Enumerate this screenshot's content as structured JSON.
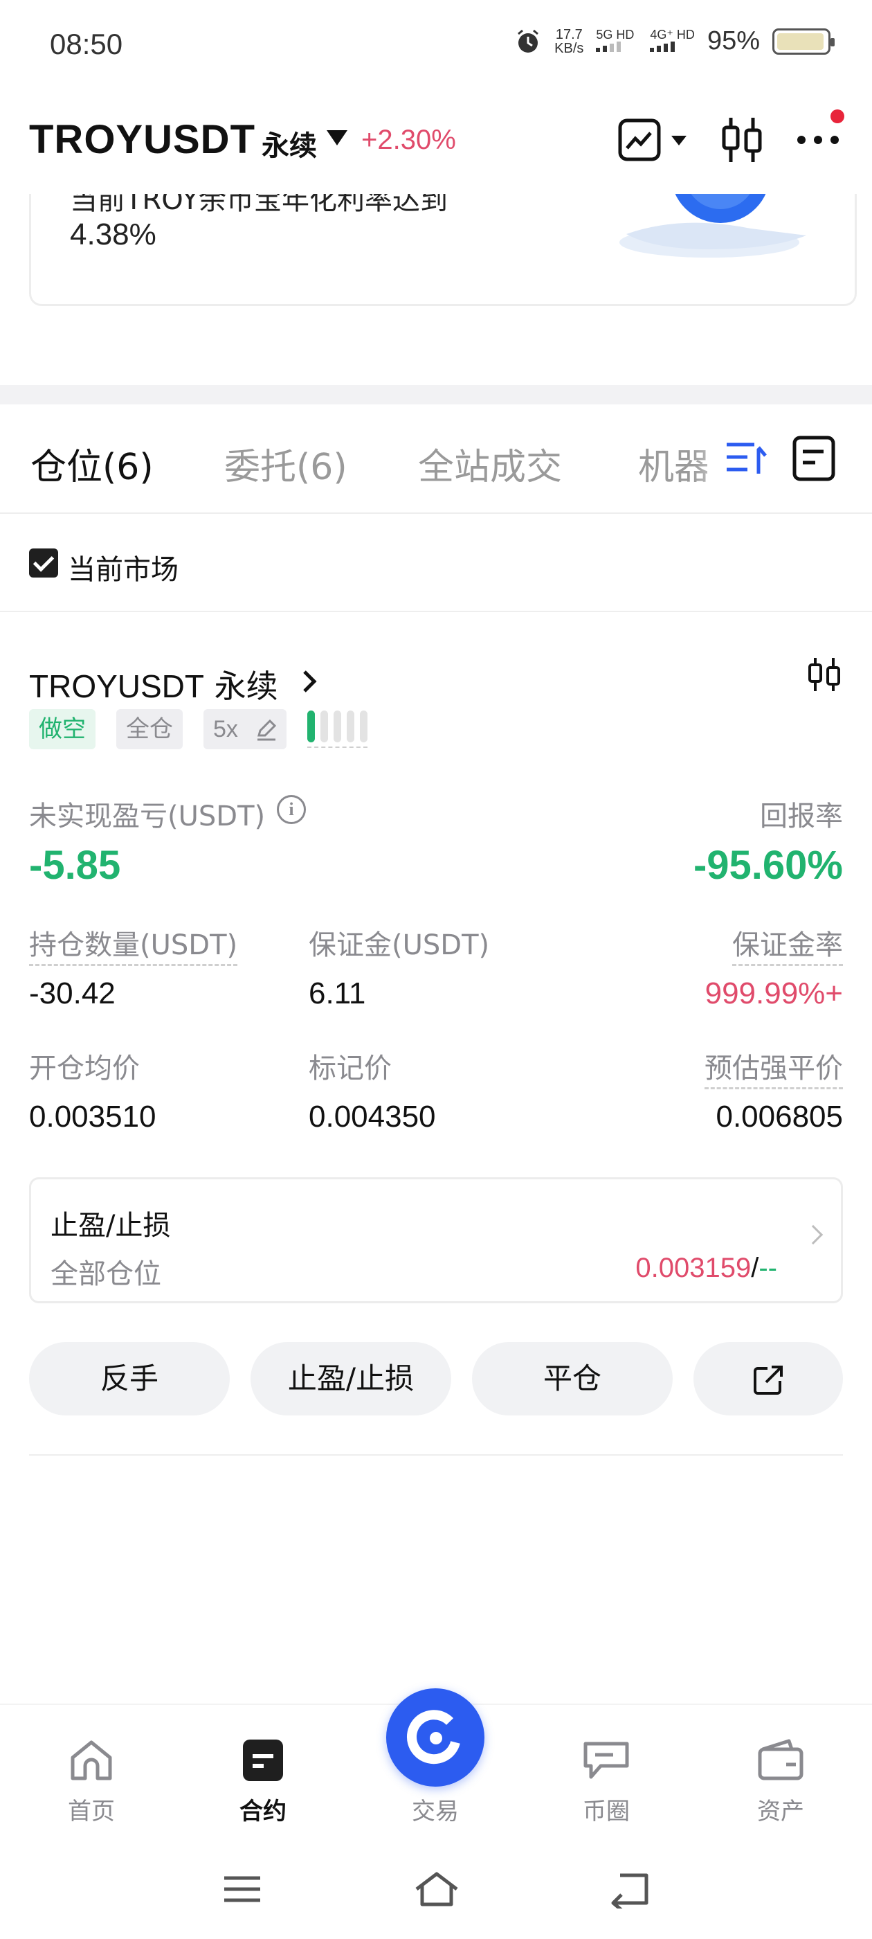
{
  "status_bar": {
    "time": "08:50",
    "net_speed_value": "17.7",
    "net_speed_unit": "KB/s",
    "sim1": "5G HD",
    "sim2": "4G⁺ HD",
    "battery": "95%",
    "icons": [
      "alarm-icon",
      "signal-icon",
      "battery-icon"
    ]
  },
  "header": {
    "symbol": "TROYUSDT",
    "contract_type": "永续",
    "change": "+2.30%",
    "icons": [
      "chart-mode-icon",
      "candlestick-icon",
      "more-icon"
    ],
    "notification_dot_color": "#e8243a"
  },
  "banner": {
    "line1": "当前TROY余币宝年化利率达到",
    "line2": "4.38%"
  },
  "tabs": [
    {
      "label": "仓位(6)",
      "active": true
    },
    {
      "label": "委托(6)",
      "active": false
    },
    {
      "label": "全站成交",
      "active": false
    },
    {
      "label": "机器",
      "active": false
    }
  ],
  "tab_icons": [
    "sort-icon",
    "record-icon"
  ],
  "filter": {
    "current_market_label": "当前市场",
    "checked": true
  },
  "position": {
    "title_symbol": "TROYUSDT",
    "title_type": "永续",
    "side_tag": "做空",
    "margin_mode_tag": "全仓",
    "leverage_tag": "5x",
    "risk_level": 1,
    "risk_total": 5,
    "unrealized_pnl_label": "未实现盈亏(USDT)",
    "unrealized_pnl": "-5.85",
    "roe_label": "回报率",
    "roe": "-95.60%",
    "size_label": "持仓数量(USDT)",
    "size": "-30.42",
    "margin_label": "保证金(USDT)",
    "margin": "6.11",
    "margin_ratio_label": "保证金率",
    "margin_ratio": "999.99%+",
    "entry_price_label": "开仓均价",
    "entry_price": "0.003510",
    "mark_price_label": "标记价",
    "mark_price": "0.004350",
    "liq_price_label": "预估强平价",
    "liq_price": "0.006805",
    "tpsl": {
      "title": "止盈/止损",
      "scope": "全部仓位",
      "tp_value": "0.003159",
      "separator": "/",
      "sl_value": "--"
    }
  },
  "actions": {
    "reverse": "反手",
    "tpsl": "止盈/止损",
    "close": "平仓"
  },
  "bottom_nav": [
    {
      "label": "首页",
      "active": false
    },
    {
      "label": "合约",
      "active": true
    },
    {
      "label": "交易",
      "active": false
    },
    {
      "label": "币圈",
      "active": false
    },
    {
      "label": "资产",
      "active": false
    }
  ],
  "colors": {
    "green": "#21b36f",
    "red": "#e04b6b",
    "accent_blue": "#2c5cf0"
  }
}
